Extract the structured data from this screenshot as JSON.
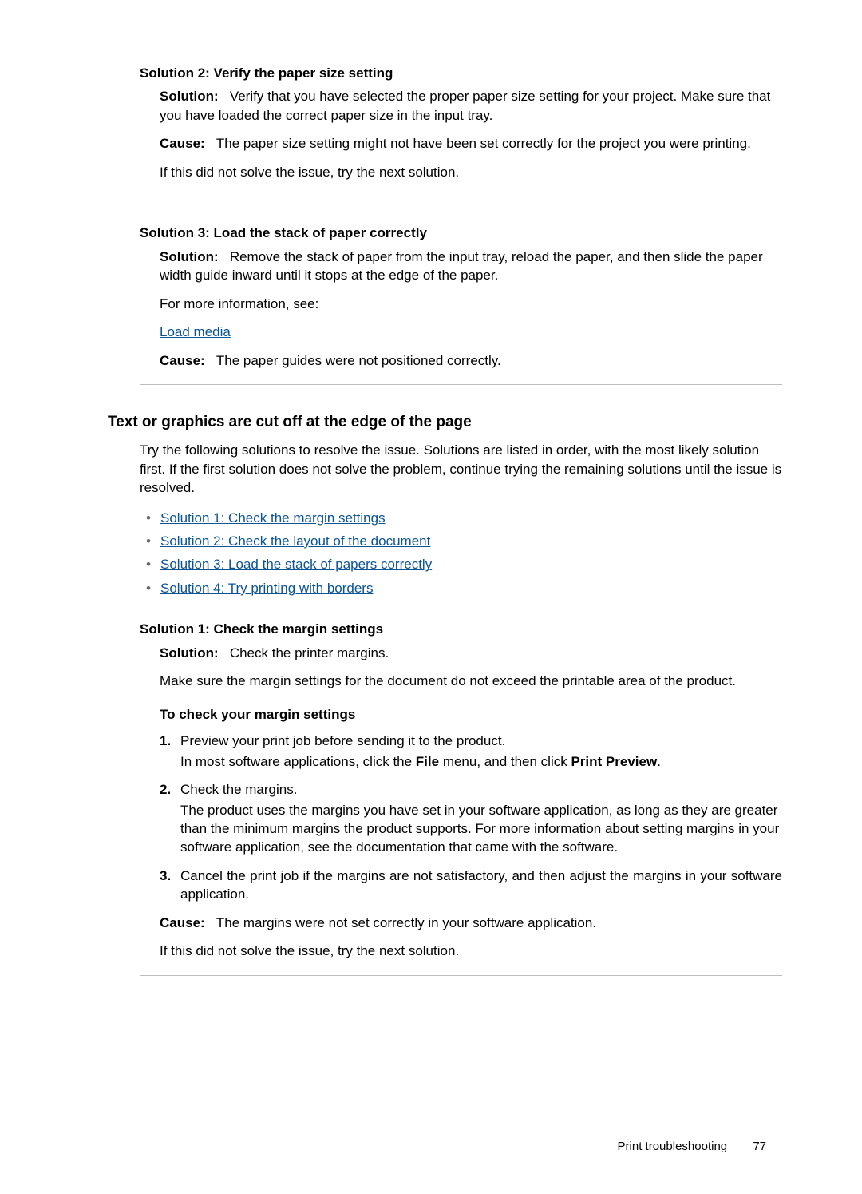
{
  "sol2": {
    "heading": "Solution 2: Verify the paper size setting",
    "solutionLabel": "Solution:",
    "solutionText": "Verify that you have selected the proper paper size setting for your project. Make sure that you have loaded the correct paper size in the input tray.",
    "causeLabel": "Cause:",
    "causeText": "The paper size setting might not have been set correctly for the project you were printing.",
    "trail": "If this did not solve the issue, try the next solution."
  },
  "sol3": {
    "heading": "Solution 3: Load the stack of paper correctly",
    "solutionLabel": "Solution:",
    "solutionText": "Remove the stack of paper from the input tray, reload the paper, and then slide the paper width guide inward until it stops at the edge of the paper.",
    "moreInfo": "For more information, see:",
    "link": "Load media",
    "causeLabel": "Cause:",
    "causeText": "The paper guides were not positioned correctly."
  },
  "section": {
    "heading": "Text or graphics are cut off at the edge of the page",
    "intro": "Try the following solutions to resolve the issue. Solutions are listed in order, with the most likely solution first. If the first solution does not solve the problem, continue trying the remaining solutions until the issue is resolved.",
    "toc": [
      "Solution 1: Check the margin settings",
      "Solution 2: Check the layout of the document",
      "Solution 3: Load the stack of papers correctly",
      "Solution 4: Try printing with borders"
    ]
  },
  "sol1": {
    "heading": "Solution 1: Check the margin settings",
    "solutionLabel": "Solution:",
    "solutionText": "Check the printer margins.",
    "body2": "Make sure the margin settings for the document do not exceed the printable area of the product.",
    "subhead": "To check your margin settings",
    "step1a": "Preview your print job before sending it to the product.",
    "step1b_pre": "In most software applications, click the ",
    "step1b_file": "File",
    "step1b_mid": " menu, and then click ",
    "step1b_pp": "Print Preview",
    "step1b_end": ".",
    "step2a": "Check the margins.",
    "step2b": "The product uses the margins you have set in your software application, as long as they are greater than the minimum margins the product supports. For more information about setting margins in your software application, see the documentation that came with the software.",
    "step3": "Cancel the print job if the margins are not satisfactory, and then adjust the margins in your software application.",
    "causeLabel": "Cause:",
    "causeText": "The margins were not set correctly in your software application.",
    "trail": "If this did not solve the issue, try the next solution."
  },
  "footer": {
    "section": "Print troubleshooting",
    "page": "77"
  }
}
